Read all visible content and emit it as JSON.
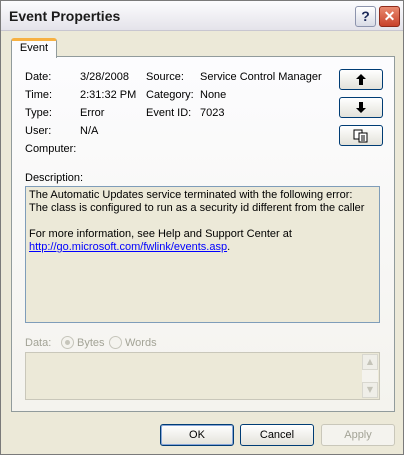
{
  "window": {
    "title": "Event Properties"
  },
  "titlebar": {
    "help_label": "?",
    "close_label": "✕"
  },
  "tabs": [
    {
      "label": "Event"
    }
  ],
  "event": {
    "date_label": "Date:",
    "date": "3/28/2008",
    "source_label": "Source:",
    "source": "Service Control Manager",
    "time_label": "Time:",
    "time": "2:31:32 PM",
    "category_label": "Category:",
    "category": "None",
    "type_label": "Type:",
    "type": "Error",
    "event_id_label": "Event ID:",
    "event_id": "7023",
    "user_label": "User:",
    "user": "N/A",
    "computer_label": "Computer:",
    "computer": ""
  },
  "nav": {
    "up_icon": "arrow-up-icon",
    "down_icon": "arrow-down-icon",
    "copy_icon": "copy-icon"
  },
  "description": {
    "label": "Description:",
    "line1": "The Automatic Updates service terminated with the following error:",
    "line2": "The class is configured to run as a security id different from the caller",
    "line3_prefix": "For more information, see Help and Support Center at",
    "link": "http://go.microsoft.com/fwlink/events.asp",
    "link_suffix": "."
  },
  "data": {
    "label": "Data:",
    "options": [
      {
        "label": "Bytes",
        "selected": true
      },
      {
        "label": "Words",
        "selected": false
      }
    ]
  },
  "buttons": {
    "ok": "OK",
    "cancel": "Cancel",
    "apply": "Apply"
  }
}
